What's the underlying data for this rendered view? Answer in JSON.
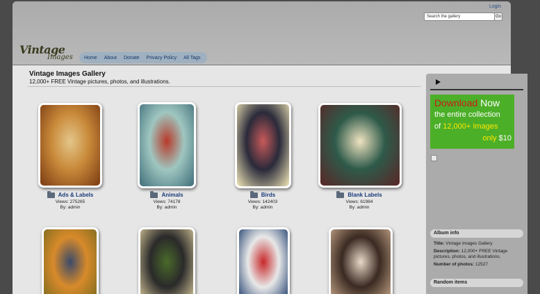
{
  "header": {
    "login_label": "Login",
    "search_placeholder": "Search the gallery",
    "search_button": "Go",
    "logo_line1": "Vintage",
    "logo_line2": "Images"
  },
  "nav": {
    "items": [
      {
        "label": "Home"
      },
      {
        "label": "About"
      },
      {
        "label": "Donate"
      },
      {
        "label": "Privacy Policy"
      },
      {
        "label": "All Tags"
      }
    ]
  },
  "main": {
    "title": "Vintage Images Gallery",
    "subtitle": "12,000+ FREE Vintage pictures, photos, and illustrations."
  },
  "albums": [
    {
      "title": "Ads & Labels",
      "views": "Views: 275265",
      "by": "By: admin",
      "icon": "folder-icon",
      "colors": [
        "#7a3a12",
        "#c98a3a",
        "#e3c68a"
      ]
    },
    {
      "title": "Animals",
      "views": "Views: 74178",
      "by": "By: admin",
      "icon": "folder-icon",
      "colors": [
        "#3f6e7a",
        "#9fc6c0",
        "#b83a2a"
      ]
    },
    {
      "title": "Birds",
      "views": "Views: 142403",
      "by": "By: admin",
      "icon": "folder-icon",
      "colors": [
        "#f2e8b8",
        "#2a2a3a",
        "#c85a5a"
      ]
    },
    {
      "title": "Blank Labels",
      "views": "Views: 61984",
      "by": "By: admin",
      "icon": "folder-icon",
      "colors": [
        "#5a2626",
        "#2e5a4a",
        "#efe3c0"
      ]
    },
    {
      "colors": [
        "#7a6a20",
        "#d88a2a",
        "#3a4a6a"
      ]
    },
    {
      "colors": [
        "#d8c89a",
        "#2a2a2a",
        "#4a6a2a"
      ]
    },
    {
      "colors": [
        "#1a3a6a",
        "#e8e8e8",
        "#c8282a"
      ]
    },
    {
      "colors": [
        "#c8a88a",
        "#3a2a22",
        "#e8d8c8"
      ]
    }
  ],
  "sidebar": {
    "promo": {
      "download": "Download",
      "now": "Now",
      "line2": "the entire collection",
      "line3_prefix": "of",
      "line3_highlight": "12,000+ Images",
      "only": "only",
      "price": "$10"
    },
    "album_info": {
      "heading": "Album info",
      "title_label": "Title:",
      "title_value": "Vintage Images Gallery",
      "desc_label": "Description:",
      "desc_value": "12,000+ FREE Vintage pictures, photos, and illustrations.",
      "count_label": "Number of photos:",
      "count_value": "12527"
    },
    "random_heading": "Random items"
  },
  "colors": {
    "background": "#4a4a4a",
    "header": "#b0b0b0",
    "nav_pill": "#9fb0c0",
    "link": "#1a3a78",
    "promo_green": "#4caf28",
    "promo_red": "#c81a1a",
    "promo_yellow": "#ffe800"
  }
}
